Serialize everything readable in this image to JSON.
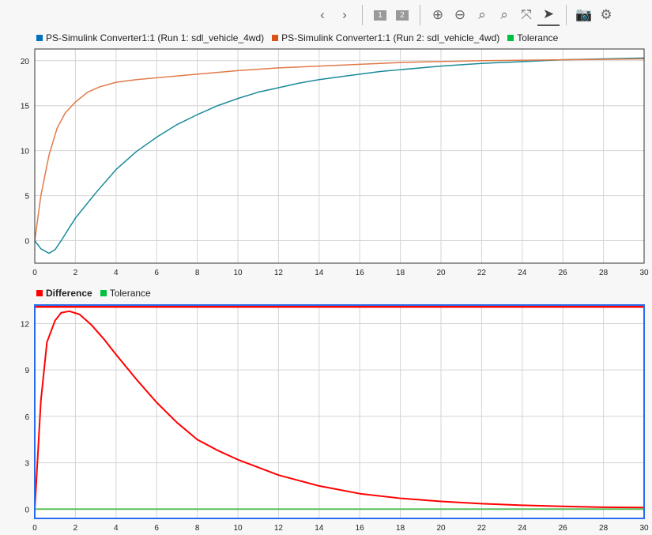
{
  "toolbar": {
    "buttons": [
      {
        "name": "back-button",
        "glyph": "‹"
      },
      {
        "name": "forward-button",
        "glyph": "›"
      },
      {
        "name": "layout-1-button",
        "glyph": "1"
      },
      {
        "name": "layout-2-button",
        "glyph": "2"
      },
      {
        "name": "zoom-in-button",
        "glyph": "⊕"
      },
      {
        "name": "zoom-out-button",
        "glyph": "⊖"
      },
      {
        "name": "zoom-time-button",
        "glyph": "⌕"
      },
      {
        "name": "zoom-y-button",
        "glyph": "⌕"
      },
      {
        "name": "fit-to-view-button",
        "glyph": "⤧"
      },
      {
        "name": "cursor-button",
        "glyph": "➤"
      },
      {
        "name": "snapshot-button",
        "glyph": "📷"
      },
      {
        "name": "settings-button",
        "glyph": "⚙"
      }
    ]
  },
  "top_legend": [
    {
      "label": "PS-Simulink Converter1:1 (Run 1: sdl_vehicle_4wd)",
      "color": "#0072bd"
    },
    {
      "label": "PS-Simulink Converter1:1 (Run 2: sdl_vehicle_4wd)",
      "color": "#d95319"
    },
    {
      "label": "Tolerance",
      "color": "#00c040"
    }
  ],
  "bottom_legend": [
    {
      "label": "Difference",
      "color": "#ff0000",
      "bold": true
    },
    {
      "label": "Tolerance",
      "color": "#00c040"
    }
  ],
  "chart_data": [
    {
      "type": "line",
      "xlim": [
        0,
        30
      ],
      "ylim": [
        -2.5,
        21.3
      ],
      "xticks": [
        0,
        2,
        4,
        6,
        8,
        10,
        12,
        14,
        16,
        18,
        20,
        22,
        24,
        26,
        28,
        30
      ],
      "yticks": [
        0,
        5,
        10,
        15,
        20
      ],
      "series": [
        {
          "name": "PS-Simulink Converter1:1 (Run 1: sdl_vehicle_4wd)",
          "color": "#1a8a9a",
          "x": [
            0,
            0.3,
            0.7,
            1,
            1.3,
            2,
            3,
            4,
            5,
            6,
            7,
            8,
            9,
            10,
            11,
            12,
            13,
            14,
            15,
            16,
            17,
            18,
            20,
            22,
            24,
            26,
            28,
            30
          ],
          "y": [
            0,
            -0.9,
            -1.4,
            -1,
            0,
            2.5,
            5.3,
            7.9,
            9.9,
            11.5,
            12.9,
            14,
            15,
            15.8,
            16.5,
            17,
            17.5,
            17.9,
            18.2,
            18.5,
            18.8,
            19,
            19.4,
            19.7,
            19.9,
            20.1,
            20.2,
            20.3
          ]
        },
        {
          "name": "PS-Simulink Converter1:1 (Run 2: sdl_vehicle_4wd)",
          "color": "#e07a4a",
          "x": [
            0,
            0.3,
            0.7,
            1.1,
            1.5,
            2,
            2.6,
            3.2,
            4,
            5,
            6,
            7,
            8.5,
            10,
            12,
            15,
            18,
            22,
            26,
            30
          ],
          "y": [
            0,
            5,
            9.5,
            12.5,
            14.2,
            15.4,
            16.5,
            17.1,
            17.6,
            17.9,
            18.1,
            18.3,
            18.6,
            18.9,
            19.2,
            19.5,
            19.8,
            20,
            20.1,
            20.2
          ]
        }
      ]
    },
    {
      "type": "line",
      "xlim": [
        0,
        30
      ],
      "ylim": [
        -0.6,
        13.2
      ],
      "xticks": [
        0,
        2,
        4,
        6,
        8,
        10,
        12,
        14,
        16,
        18,
        20,
        22,
        24,
        26,
        28,
        30
      ],
      "yticks": [
        0,
        3,
        6,
        9,
        12
      ],
      "series": [
        {
          "name": "Difference",
          "color": "#ff0000",
          "x": [
            0,
            0.3,
            0.6,
            1,
            1.3,
            1.7,
            2.2,
            2.8,
            3.4,
            4,
            5,
            6,
            7,
            8,
            9,
            10,
            12,
            14,
            16,
            18,
            20,
            22,
            24,
            26,
            28,
            30
          ],
          "y": [
            0,
            7,
            10.8,
            12.2,
            12.7,
            12.8,
            12.6,
            11.9,
            11,
            10,
            8.4,
            6.9,
            5.6,
            4.5,
            3.8,
            3.2,
            2.2,
            1.5,
            1,
            0.7,
            0.5,
            0.35,
            0.25,
            0.18,
            0.12,
            0.1
          ]
        },
        {
          "name": "Tolerance",
          "color": "#5cbf5c",
          "x": [
            0,
            30
          ],
          "y": [
            0,
            0
          ]
        }
      ]
    }
  ]
}
